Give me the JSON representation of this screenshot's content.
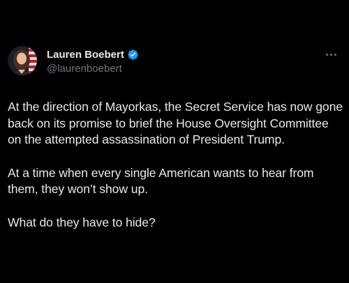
{
  "author": {
    "display_name": "Lauren Boebert",
    "handle": "@laurenboebert",
    "verified": true,
    "verified_color": "#1d9bf0"
  },
  "tweet": {
    "paragraphs": [
      "At the direction of Mayorkas, the Secret Service has now gone back on its promise to brief the House Oversight Committee on the attempted assassination of President Trump.",
      "At a time when every single American wants to hear from them, they won’t show up.",
      "What do they have to hide?"
    ]
  },
  "icons": {
    "avatar": "avatar",
    "verified": "verified-badge-icon",
    "more": "more-options-icon"
  }
}
